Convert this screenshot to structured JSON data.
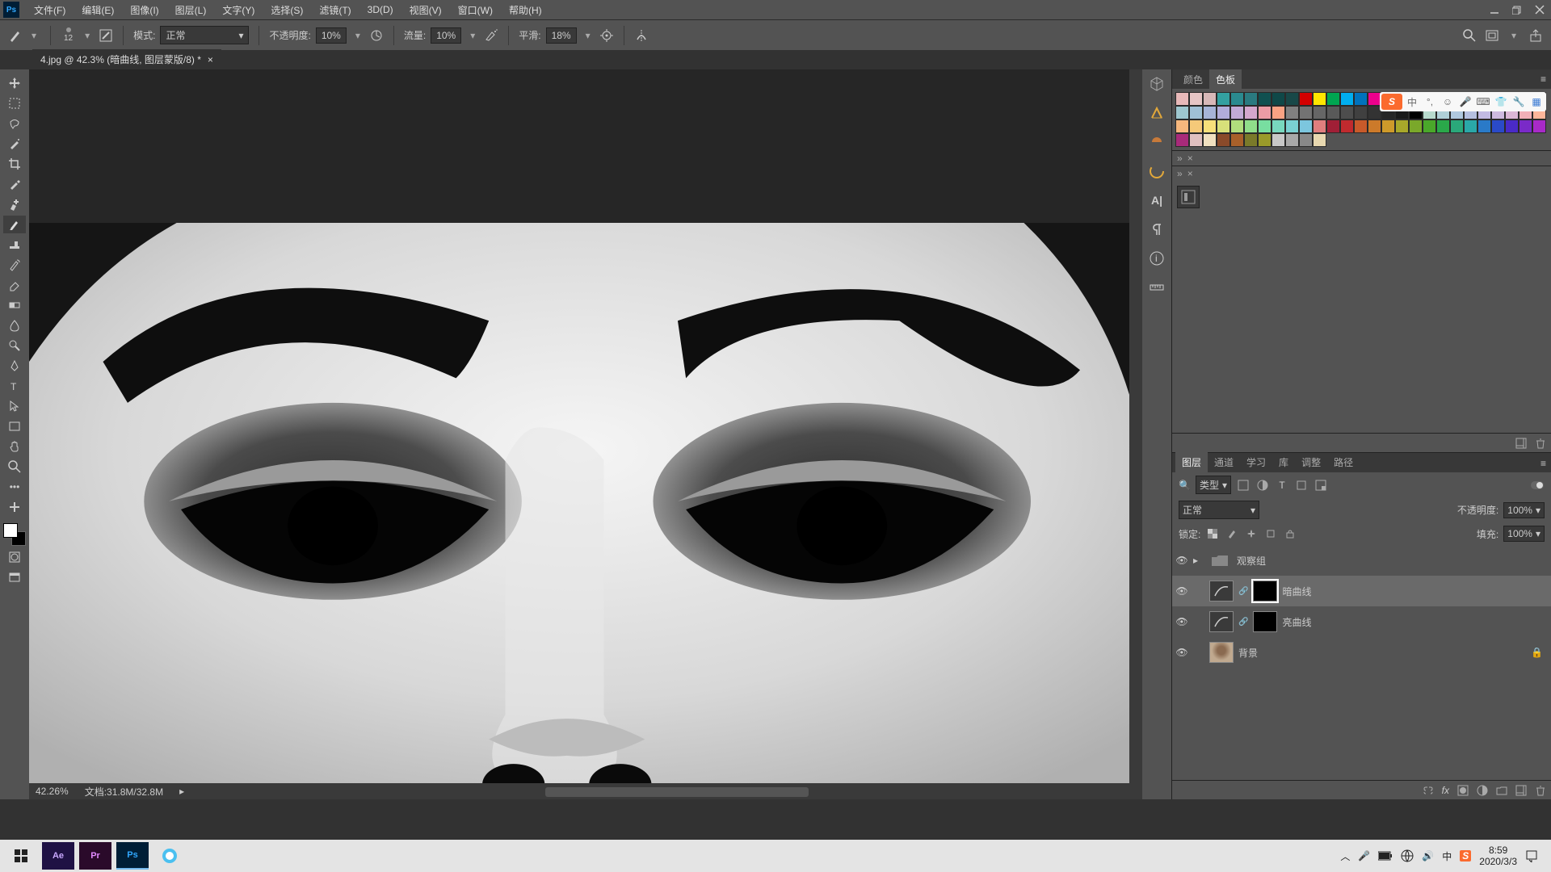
{
  "menubar": {
    "items": [
      "文件(F)",
      "编辑(E)",
      "图像(I)",
      "图层(L)",
      "文字(Y)",
      "选择(S)",
      "滤镜(T)",
      "3D(D)",
      "视图(V)",
      "窗口(W)",
      "帮助(H)"
    ]
  },
  "optbar": {
    "brush_size": "12",
    "mode_label": "模式:",
    "mode_value": "正常",
    "opacity_label": "不透明度:",
    "opacity_value": "10%",
    "flow_label": "流量:",
    "flow_value": "10%",
    "smooth_label": "平滑:",
    "smooth_value": "18%"
  },
  "doc_tab": {
    "title": "4.jpg @ 42.3% (暗曲线, 图层蒙版/8) *"
  },
  "status": {
    "zoom": "42.26%",
    "doc_label": "文档:",
    "doc_size": "31.8M/32.8M"
  },
  "color_panel": {
    "tabs": [
      "颜色",
      "色板"
    ],
    "swatches": [
      "#e8b9b9",
      "#e6c5c5",
      "#d8b8b8",
      "#33a0a0",
      "#2a8a8f",
      "#2a7a80",
      "#105050",
      "#0f4848",
      "#184848",
      "#d40000",
      "#ffe600",
      "#00a651",
      "#00aeef",
      "#0072bc",
      "#ec008c",
      "#ffffff",
      "#f2f2f2",
      "#e6e6e6",
      "#d9d9d9",
      "#cccccc",
      "#bfbfbf",
      "#b3b3b3",
      "#a6a6a6",
      "#999999",
      "#ff0000",
      "#fff200",
      "#a3d5c8",
      "#9ec7cf",
      "#a0c0d6",
      "#a6b4d8",
      "#b1adda",
      "#c2aad6",
      "#d4a7cd",
      "#eb9ca5",
      "#f9a283",
      "#808080",
      "#737373",
      "#666666",
      "#595959",
      "#4d4d4d",
      "#404040",
      "#333333",
      "#262626",
      "#1a1a1a",
      "#000000",
      "#b8dacd",
      "#b0d0d8",
      "#b0c8de",
      "#b6c0e0",
      "#c2bae2",
      "#cebade",
      "#dab7d5",
      "#f1b0b7",
      "#fdb69a",
      "#f6b77d",
      "#f5c979",
      "#f7e07a",
      "#d8e07a",
      "#b0de7d",
      "#90de8a",
      "#78dea0",
      "#78d8be",
      "#7ad0d2",
      "#7cc6de",
      "#e07e7e",
      "#a01f36",
      "#c02a2e",
      "#c85a2a",
      "#cc7a2a",
      "#ce9a2a",
      "#a8a82a",
      "#7aa82a",
      "#4aa82a",
      "#2aa84a",
      "#2aa87a",
      "#2aa8a8",
      "#2a7ac8",
      "#2a4ac8",
      "#4a2ac8",
      "#7a2ac8",
      "#a82ac8",
      "#a82a7a",
      "#e0c0c0",
      "#f0e0c0",
      "#8a4a2a",
      "#a8602a",
      "#7a7a2a",
      "#9a9a2a",
      "#c8c8c8",
      "#a8a8a8",
      "#888888",
      "#e8d8b0"
    ]
  },
  "ime": {
    "s": "S",
    "lang": "中"
  },
  "layers_panel": {
    "tabs": [
      "图层",
      "通道",
      "学习",
      "库",
      "调整",
      "路径"
    ],
    "filter_label": "类型",
    "blend_mode": "正常",
    "opacity_label": "不透明度:",
    "opacity_value": "100%",
    "lock_label": "锁定:",
    "fill_label": "填充:",
    "fill_value": "100%",
    "rows": [
      {
        "type": "group",
        "name": "观察组",
        "selected": false
      },
      {
        "type": "adj",
        "name": "暗曲线",
        "selected": true,
        "mask": true
      },
      {
        "type": "adj",
        "name": "亮曲线",
        "selected": false,
        "mask": true
      },
      {
        "type": "image",
        "name": "背景",
        "selected": false,
        "locked": true
      }
    ]
  },
  "taskbar": {
    "time": "8:59",
    "date": "2020/3/3"
  }
}
